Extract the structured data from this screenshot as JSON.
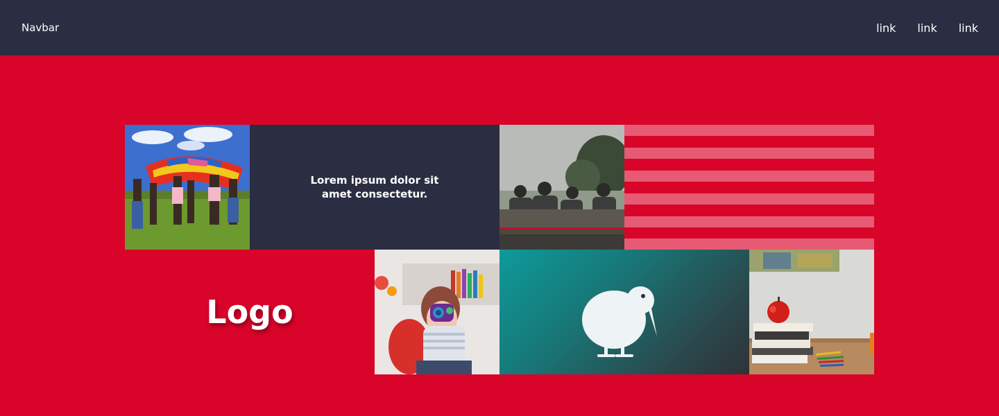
{
  "navbar": {
    "brand": "Navbar",
    "links": [
      "link",
      "link",
      "link"
    ]
  },
  "content": {
    "tagline": "Lorem ipsum dolor sit amet consectetur.",
    "logo": "Logo"
  },
  "images": {
    "parachute": "children-playing-with-rainbow-parachute",
    "bench": "children-sitting-on-bench",
    "girl": "toddler-holding-toy-camera",
    "apple": "apple-on-books-with-pencils"
  },
  "icons": {
    "kiwi": "kiwi-bird-icon"
  },
  "colors": {
    "navbar_bg": "#2b2d42",
    "page_bg": "#d90429",
    "accent_teal": "#0e9a9a"
  }
}
